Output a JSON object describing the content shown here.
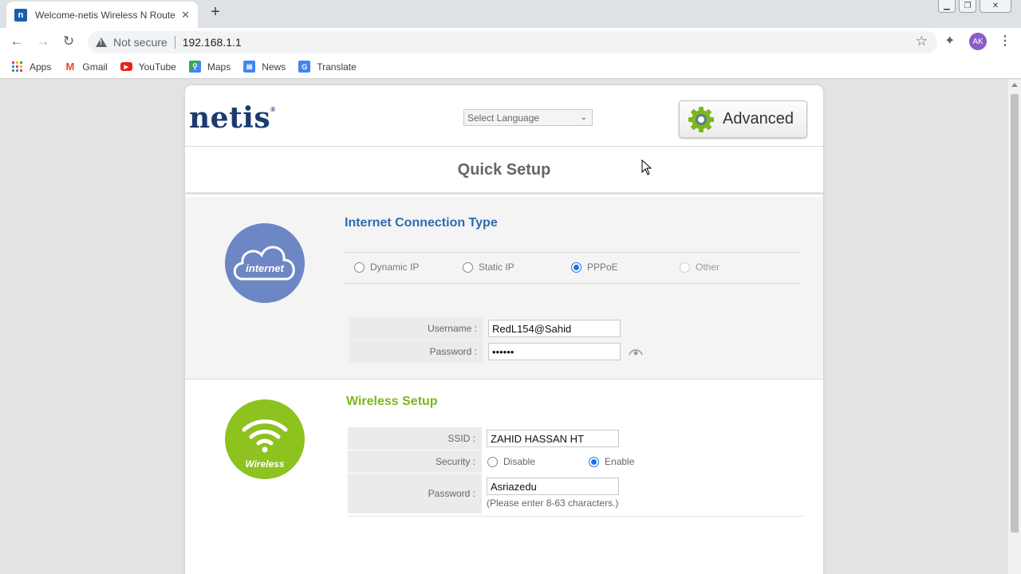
{
  "browser": {
    "tab_title": "Welcome-netis Wireless N Router",
    "tab_close": "✕",
    "new_tab": "+",
    "security_text": "Not secure",
    "url": "192.168.1.1",
    "avatar_initials": "AK",
    "bookmarks": [
      {
        "label": "Apps",
        "icon": "apps-grid-icon"
      },
      {
        "label": "Gmail",
        "icon": "gmail-icon"
      },
      {
        "label": "YouTube",
        "icon": "youtube-icon"
      },
      {
        "label": "Maps",
        "icon": "maps-icon"
      },
      {
        "label": "News",
        "icon": "news-icon"
      },
      {
        "label": "Translate",
        "icon": "translate-icon"
      }
    ]
  },
  "header": {
    "logo": "netis",
    "logo_mark": "®",
    "language_select": "Select Language",
    "advanced_label": "Advanced"
  },
  "quick_setup": {
    "title": "Quick Setup"
  },
  "internet": {
    "icon_label": "internet",
    "title": "Internet Connection Type",
    "types": [
      {
        "label": "Dynamic IP",
        "checked": false
      },
      {
        "label": "Static IP",
        "checked": false
      },
      {
        "label": "PPPoE",
        "checked": true
      },
      {
        "label": "Other",
        "checked": false,
        "disabled": true
      }
    ],
    "username_label": "Username :",
    "username_value": "RedL154@Sahid",
    "password_label": "Password :",
    "password_value": "••••••"
  },
  "wireless": {
    "icon_label": "Wireless",
    "title": "Wireless Setup",
    "ssid_label": "SSID :",
    "ssid_value": "ZAHID HASSAN HT",
    "security_label": "Security :",
    "security_options": [
      {
        "label": "Disable",
        "checked": false
      },
      {
        "label": "Enable",
        "checked": true
      }
    ],
    "password_label": "Password :",
    "password_value": "Asriazedu",
    "password_hint": "(Please enter 8-63 characters.)"
  },
  "colors": {
    "logo": "#1b3b6f",
    "internet_blue": "#2e6bb0",
    "wireless_green": "#7cb71b",
    "internet_circle": "#6d86c4",
    "wireless_circle": "#8dc21f"
  }
}
